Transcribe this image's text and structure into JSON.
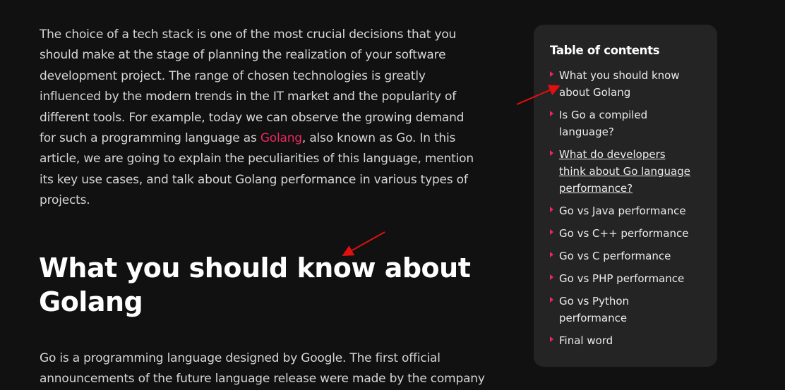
{
  "intro_paragraph": {
    "lines": [
      "The choice of a tech stack is one of the most crucial decisions that you",
      "should make at the stage of planning the realization of your software",
      "development project. The range of chosen technologies is greatly",
      "influenced by the modern trends in the IT market and the popularity of",
      "different tools. For example, today we can observe the growing demand"
    ],
    "line6_before": "for such a programming language as ",
    "line6_link": "Golang",
    "line6_after": ", also known as Go. In this",
    "lines_rest": [
      "article, we are going to explain the peculiarities of this language, mention",
      "its key use cases, and talk about Golang performance in various types of",
      "projects."
    ]
  },
  "heading": {
    "lines": [
      "What you should know about",
      "Golang"
    ]
  },
  "second_paragraph": {
    "lines": [
      "Go is a programming language designed by Google. The first official",
      "announcements of the future language release were made by the company"
    ]
  },
  "toc": {
    "title": "Table of contents",
    "items": [
      {
        "lines": [
          "What you should know",
          "about Golang"
        ]
      },
      {
        "lines": [
          "Is Go a compiled",
          "language?"
        ]
      },
      {
        "lines": [
          "What do developers ",
          "think about Go language ",
          "performance?"
        ],
        "underlined": true
      },
      {
        "lines": [
          "Go vs Java performance"
        ]
      },
      {
        "lines": [
          "Go vs C++ performance"
        ]
      },
      {
        "lines": [
          "Go vs C performance"
        ]
      },
      {
        "lines": [
          "Go vs PHP performance"
        ]
      },
      {
        "lines": [
          "Go vs Python",
          "performance"
        ]
      },
      {
        "lines": [
          "Final word"
        ]
      }
    ]
  },
  "colors": {
    "background": "#111111",
    "panel": "#242424",
    "accent": "#e8285f",
    "annotation_arrow": "#e01010"
  }
}
